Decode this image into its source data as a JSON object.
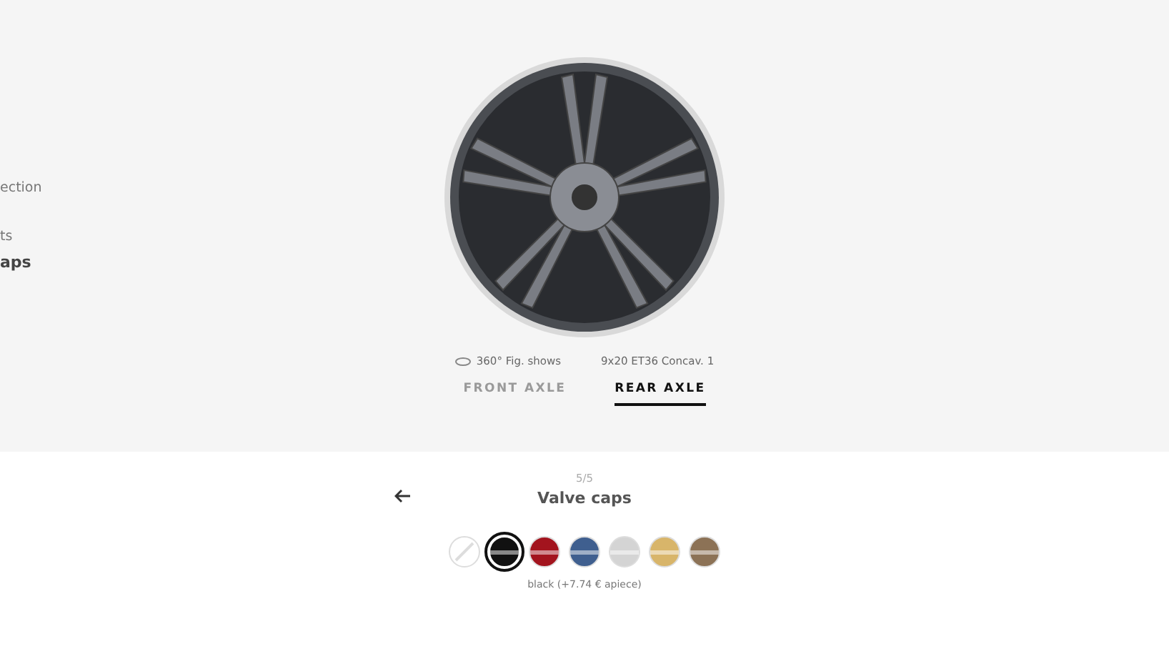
{
  "side_menu": [
    {
      "label": "ection",
      "selected": false
    },
    {
      "label": "ts",
      "selected": false
    },
    {
      "label": "aps",
      "selected": true
    }
  ],
  "wheel_info": {
    "view_label": "360° Fig. shows",
    "spec": "9x20 ET36 Concav. 1"
  },
  "axle_tabs": [
    {
      "label": "FRONT AXLE",
      "selected": false
    },
    {
      "label": "REAR AXLE",
      "selected": true
    }
  ],
  "step": {
    "counter": "5/5",
    "title": "Valve caps"
  },
  "swatches": [
    {
      "kind": "none",
      "selected": false
    },
    {
      "kind": "color",
      "color": "#111111",
      "selected": true
    },
    {
      "kind": "color",
      "color": "#a3141e",
      "selected": false
    },
    {
      "kind": "color",
      "color": "#3f5f8f",
      "selected": false
    },
    {
      "kind": "color",
      "color": "#d4d4d4",
      "selected": false
    },
    {
      "kind": "color",
      "color": "#d8b56a",
      "selected": false
    },
    {
      "kind": "color",
      "color": "#8c7256",
      "selected": false
    }
  ],
  "selection_label": "black (+7.74 € apiece)"
}
